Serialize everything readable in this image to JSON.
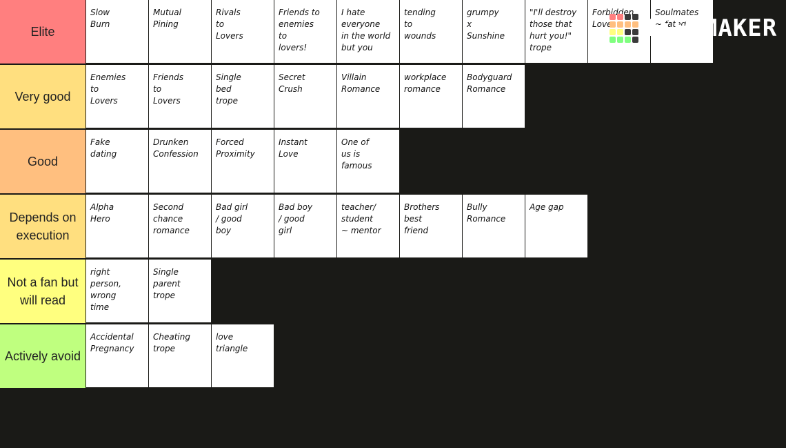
{
  "logo": {
    "text": "TiERMAKER",
    "grid": [
      "#ff7f7f",
      "#ff7f7f",
      "#3a3a3a",
      "#3a3a3a",
      "#ffbf7f",
      "#ffbf7f",
      "#ffbf7f",
      "#ffbf7f",
      "#ffff7f",
      "#ffff7f",
      "#3a3a3a",
      "#3a3a3a",
      "#7fff7f",
      "#7fff7f",
      "#7fff7f",
      "#3a3a3a"
    ]
  },
  "tiers": [
    {
      "label": "Elite",
      "color": "#ff7f7f",
      "items": [
        "Slow\nBurn",
        "Mutual\nPining",
        "Rivals\nto\nLovers",
        "Friends to\nenemies\nto\nlovers!",
        "I hate\neveryone\nin the world\nbut you",
        "tending\nto\nwounds",
        "grumpy\nx\nSunshine",
        "\"I'll destroy\nthose that\nhurt you!\"\ntrope",
        "Forbidden\nLove",
        "Soulmates\n~ fated"
      ]
    },
    {
      "label": "Very good",
      "color": "#ffdf7f",
      "items": [
        "Enemies\nto\nLovers",
        "Friends\nto\nLovers",
        "Single\nbed\ntrope",
        "Secret\nCrush",
        "Villain\nRomance",
        "workplace\nromance",
        "Bodyguard\nRomance"
      ]
    },
    {
      "label": "Good",
      "color": "#ffbf7f",
      "items": [
        "Fake\ndating",
        "Drunken\nConfession",
        "Forced\nProximity",
        "Instant\nLove",
        "One of\nus is\nfamous"
      ]
    },
    {
      "label": "Depends on execution",
      "color": "#ffdf7f",
      "items": [
        "Alpha\nHero",
        "Second\nchance\nromance",
        "Bad girl\n/ good\nboy",
        "Bad boy\n/ good\ngirl",
        "teacher/\nstudent\n~ mentor",
        "Brothers\nbest\nfriend",
        "Bully\nRomance",
        "Age gap"
      ]
    },
    {
      "label": "Not a fan but will read",
      "color": "#ffff7f",
      "items": [
        "right\nperson, wrong\ntime",
        "Single\nparent\ntrope"
      ]
    },
    {
      "label": "Actively avoid",
      "color": "#bfff7f",
      "items": [
        "Accidental\nPregnancy",
        "Cheating\ntrope",
        "love\ntriangle"
      ]
    }
  ]
}
